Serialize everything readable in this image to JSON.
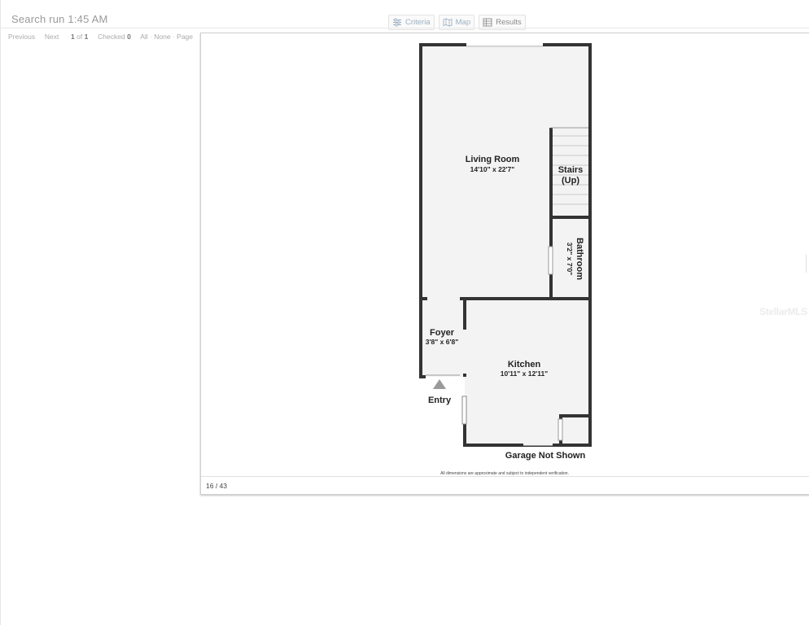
{
  "header": {
    "search_title": "Search run 1:45 AM"
  },
  "tabs": [
    {
      "label": "Criteria",
      "icon": "sliders-icon"
    },
    {
      "label": "Map",
      "icon": "map-icon"
    },
    {
      "label": "Results",
      "icon": "grid-icon"
    }
  ],
  "nav": {
    "previous": "Previous",
    "next": "Next",
    "page_current": "1",
    "of_label": "of",
    "page_total": "1",
    "checked_label": "Checked",
    "checked_count": "0",
    "all": "All",
    "none": "None",
    "page": "Page"
  },
  "viewer": {
    "counter": "16 / 43",
    "watermark": "StellarMLS"
  },
  "floorplan": {
    "rooms": [
      {
        "name": "Living Room",
        "dims": "14'10\" x 22'7\""
      },
      {
        "name": "Stairs",
        "dims": "(Up)"
      },
      {
        "name": "Bathroom",
        "dims": "3'2\" x 7'0\""
      },
      {
        "name": "Foyer",
        "dims": "3'8\" x 6'8\""
      },
      {
        "name": "Kitchen",
        "dims": "10'11\" x 12'11\""
      }
    ],
    "entry_label": "Entry",
    "garage_label": "Garage Not Shown",
    "disclaimer": "All dimensions are approximate and subject to independent verification."
  },
  "colors": {
    "wall": "#333333",
    "floor": "#f3f3f3",
    "tab_text": "#9bb0c4"
  }
}
